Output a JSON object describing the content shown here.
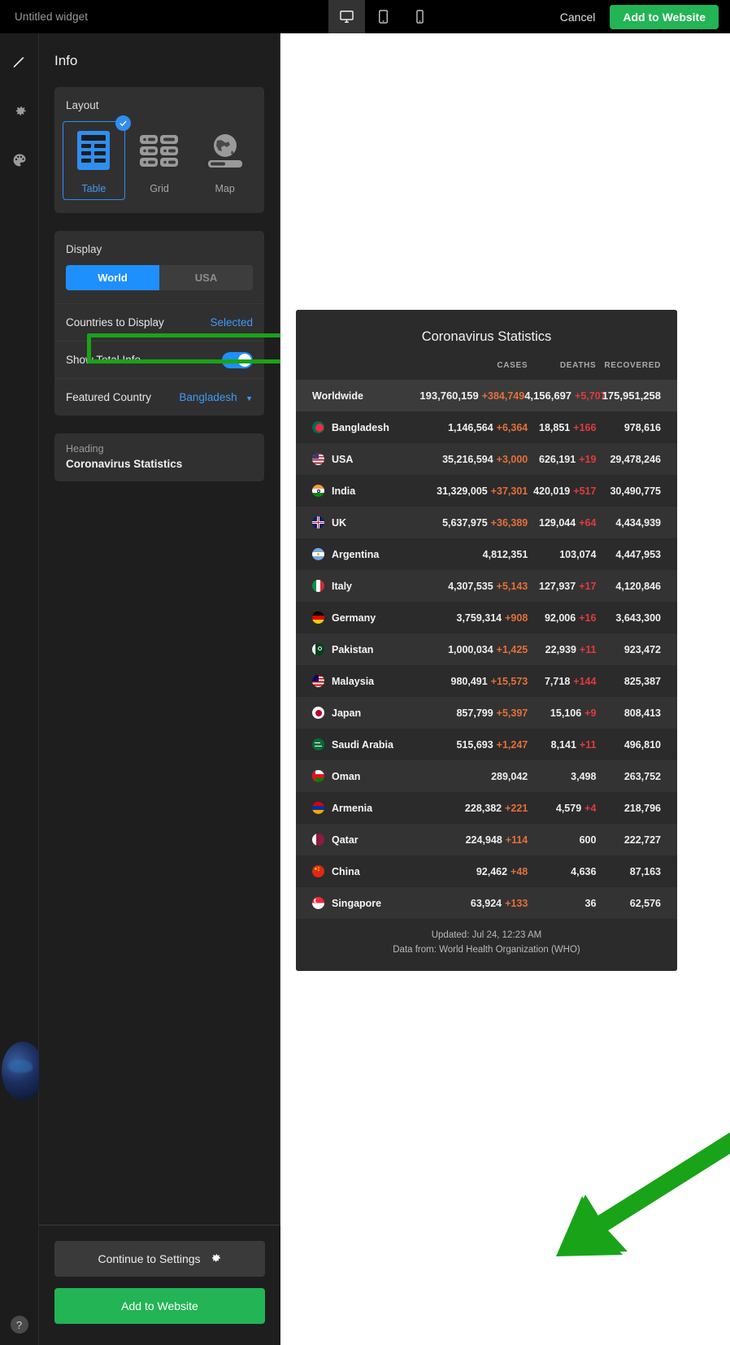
{
  "topbar": {
    "widget_title": "Untitled widget",
    "devices": [
      {
        "name": "desktop",
        "icon": "monitor-icon",
        "active": true
      },
      {
        "name": "tablet",
        "icon": "tablet-icon",
        "active": false
      },
      {
        "name": "mobile",
        "icon": "phone-icon",
        "active": false
      }
    ],
    "cancel_label": "Cancel",
    "add_label": "Add to Website"
  },
  "rail": {
    "icons": [
      "pencil-icon",
      "gear-icon",
      "palette-icon"
    ],
    "help_label": "?"
  },
  "panel": {
    "title": "Info",
    "layout": {
      "label": "Layout",
      "options": [
        {
          "label": "Table",
          "selected": true
        },
        {
          "label": "Grid",
          "selected": false
        },
        {
          "label": "Map",
          "selected": false
        }
      ]
    },
    "display": {
      "label": "Display",
      "segments": [
        {
          "label": "World",
          "active": true
        },
        {
          "label": "USA",
          "active": false
        }
      ],
      "countries_label": "Countries to Display",
      "countries_value": "Selected",
      "total_info_label": "Show Total Info",
      "total_info_on": true,
      "featured_label": "Featured Country",
      "featured_value": "Bangladesh"
    },
    "heading": {
      "label": "Heading",
      "value": "Coronavirus Statistics"
    },
    "footer": {
      "settings_label": "Continue to Settings",
      "add_label": "Add to Website"
    }
  },
  "widget": {
    "title": "Coronavirus Statistics",
    "columns": [
      "CASES",
      "DEATHS",
      "RECOVERED"
    ],
    "total_row": {
      "name": "Worldwide",
      "cases": "193,760,159",
      "cases_delta": "+384,749",
      "deaths": "4,156,697",
      "deaths_delta": "+5,707",
      "recovered": "175,951,258"
    },
    "rows": [
      {
        "name": "Bangladesh",
        "flag": "bd",
        "cases": "1,146,564",
        "cases_delta": "+6,364",
        "deaths": "18,851",
        "deaths_delta": "+166",
        "recovered": "978,616"
      },
      {
        "name": "USA",
        "flag": "us",
        "cases": "35,216,594",
        "cases_delta": "+3,000",
        "deaths": "626,191",
        "deaths_delta": "+19",
        "recovered": "29,478,246"
      },
      {
        "name": "India",
        "flag": "in",
        "cases": "31,329,005",
        "cases_delta": "+37,301",
        "deaths": "420,019",
        "deaths_delta": "+517",
        "recovered": "30,490,775"
      },
      {
        "name": "UK",
        "flag": "gb",
        "cases": "5,637,975",
        "cases_delta": "+36,389",
        "deaths": "129,044",
        "deaths_delta": "+64",
        "recovered": "4,434,939"
      },
      {
        "name": "Argentina",
        "flag": "ar",
        "cases": "4,812,351",
        "cases_delta": "",
        "deaths": "103,074",
        "deaths_delta": "",
        "recovered": "4,447,953"
      },
      {
        "name": "Italy",
        "flag": "it",
        "cases": "4,307,535",
        "cases_delta": "+5,143",
        "deaths": "127,937",
        "deaths_delta": "+17",
        "recovered": "4,120,846"
      },
      {
        "name": "Germany",
        "flag": "de",
        "cases": "3,759,314",
        "cases_delta": "+908",
        "deaths": "92,006",
        "deaths_delta": "+16",
        "recovered": "3,643,300"
      },
      {
        "name": "Pakistan",
        "flag": "pk",
        "cases": "1,000,034",
        "cases_delta": "+1,425",
        "deaths": "22,939",
        "deaths_delta": "+11",
        "recovered": "923,472"
      },
      {
        "name": "Malaysia",
        "flag": "my",
        "cases": "980,491",
        "cases_delta": "+15,573",
        "deaths": "7,718",
        "deaths_delta": "+144",
        "recovered": "825,387"
      },
      {
        "name": "Japan",
        "flag": "jp",
        "cases": "857,799",
        "cases_delta": "+5,397",
        "deaths": "15,106",
        "deaths_delta": "+9",
        "recovered": "808,413"
      },
      {
        "name": "Saudi Arabia",
        "flag": "sa",
        "cases": "515,693",
        "cases_delta": "+1,247",
        "deaths": "8,141",
        "deaths_delta": "+11",
        "recovered": "496,810"
      },
      {
        "name": "Oman",
        "flag": "om",
        "cases": "289,042",
        "cases_delta": "",
        "deaths": "3,498",
        "deaths_delta": "",
        "recovered": "263,752"
      },
      {
        "name": "Armenia",
        "flag": "am",
        "cases": "228,382",
        "cases_delta": "+221",
        "deaths": "4,579",
        "deaths_delta": "+4",
        "recovered": "218,796"
      },
      {
        "name": "Qatar",
        "flag": "qa",
        "cases": "224,948",
        "cases_delta": "+114",
        "deaths": "600",
        "deaths_delta": "",
        "recovered": "222,727"
      },
      {
        "name": "China",
        "flag": "cn",
        "cases": "92,462",
        "cases_delta": "+48",
        "deaths": "4,636",
        "deaths_delta": "",
        "recovered": "87,163"
      },
      {
        "name": "Singapore",
        "flag": "sg",
        "cases": "63,924",
        "cases_delta": "+133",
        "deaths": "36",
        "deaths_delta": "",
        "recovered": "62,576"
      }
    ],
    "updated": "Updated: Jul 24, 12:23 AM",
    "source": "Data from: World Health Organization (WHO)"
  },
  "colors": {
    "accent_blue": "#1e8fff",
    "accent_green": "#22b455",
    "cases_delta": "#e2703a",
    "deaths_delta": "#e23b3b",
    "annotation_green": "#19a319"
  }
}
